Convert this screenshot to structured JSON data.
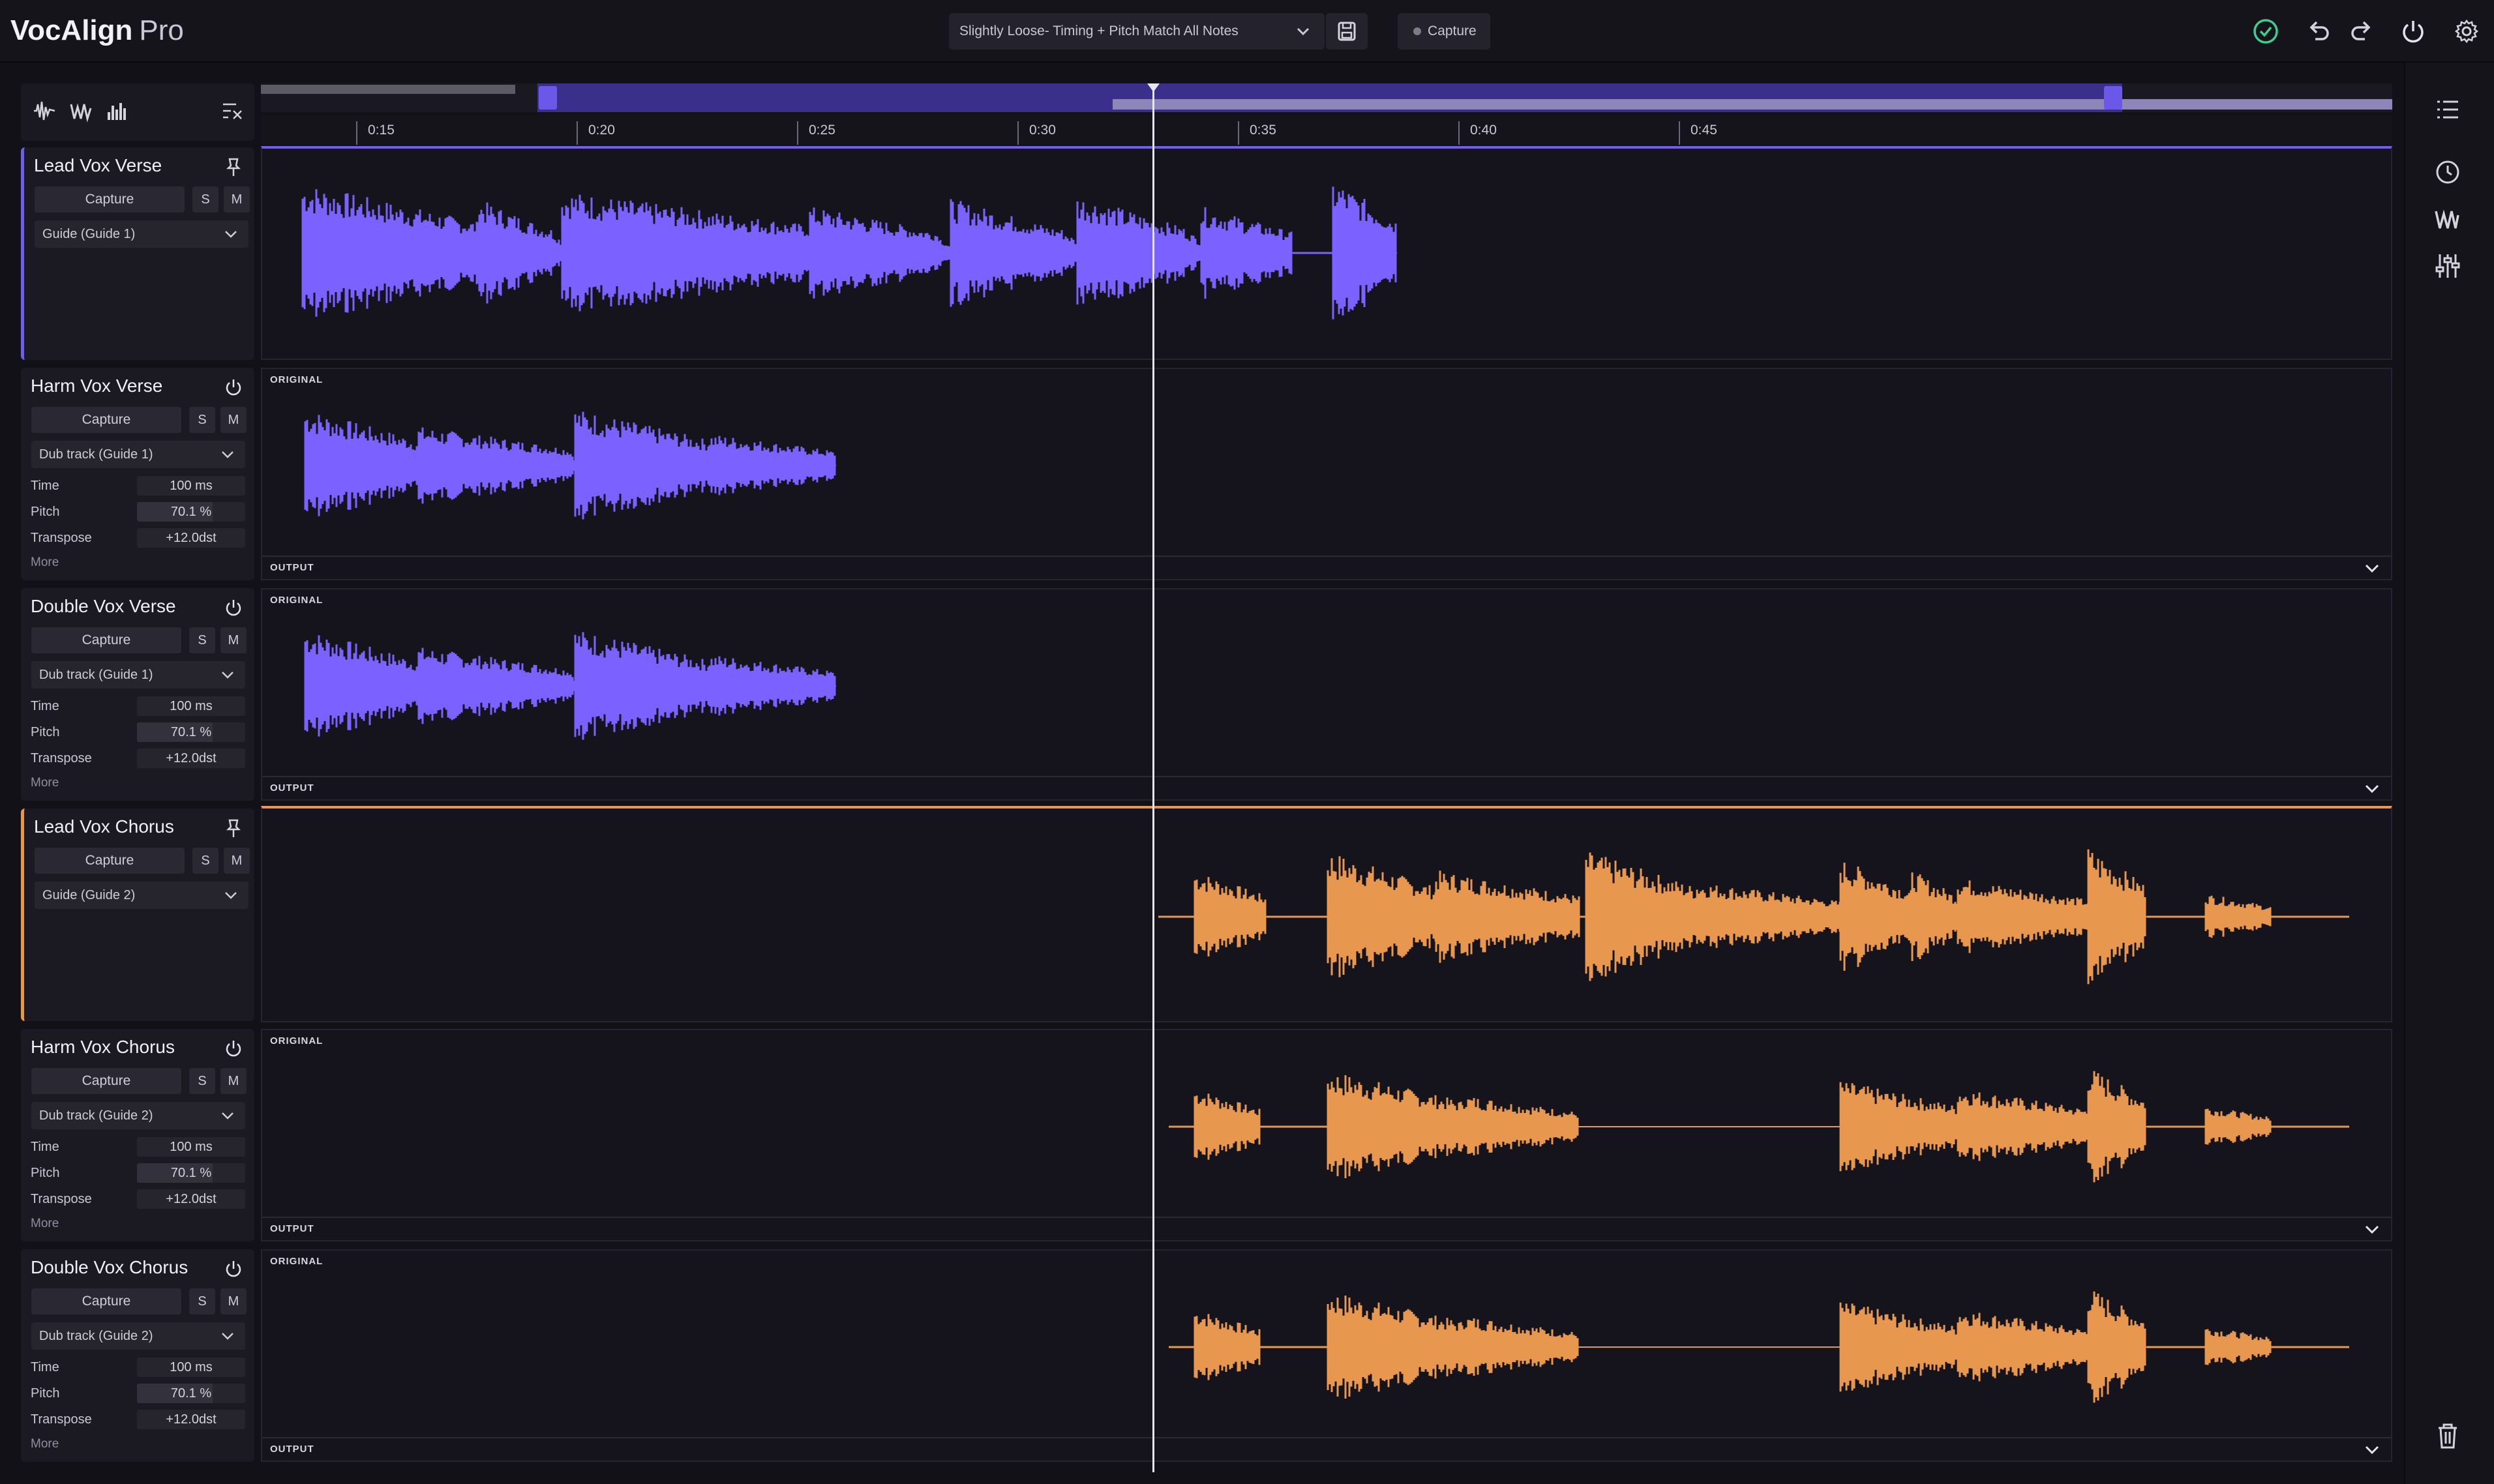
{
  "app": {
    "name_bold": "VocAlign",
    "name_light": "Pro"
  },
  "toolbar": {
    "preset": "Slightly Loose- Timing + Pitch Match All Notes",
    "capture_label": "Capture"
  },
  "colors": {
    "guide1": "#7b61ff",
    "guide2": "#e8974f",
    "background": "#121118",
    "status_ok": "#3ecf8e"
  },
  "icons": {
    "top_right": [
      "check-circle-icon",
      "undo-icon",
      "redo-icon",
      "power-icon",
      "gear-icon"
    ],
    "right_panel": [
      "list-icon",
      "clock-icon",
      "waveform-w-icon",
      "sliders-icon",
      "trash-icon"
    ],
    "tools": [
      "waveform-tool-icon",
      "pitch-tool-icon",
      "bars-tool-icon",
      "clear-tool-icon"
    ]
  },
  "ruler": {
    "ticks": [
      "0:15",
      "0:20",
      "0:25",
      "0:30",
      "0:35",
      "0:40",
      "0:45"
    ]
  },
  "labels": {
    "original": "ORIGINAL",
    "output": "OUTPUT",
    "capture": "Capture",
    "solo": "S",
    "mute": "M",
    "time": "Time",
    "pitch": "Pitch",
    "transpose": "Transpose",
    "more": "More"
  },
  "tracks": [
    {
      "name": "Lead Vox Verse",
      "role": "Guide (Guide 1)",
      "type": "guide",
      "group": 1
    },
    {
      "name": "Harm Vox Verse",
      "role": "Dub track (Guide 1)",
      "type": "dub",
      "group": 1,
      "time": "100 ms",
      "pitch": "70.1 %",
      "pitch_level": 0.701,
      "transpose": "+12.0dst"
    },
    {
      "name": "Double Vox Verse",
      "role": "Dub track (Guide 1)",
      "type": "dub",
      "group": 1,
      "time": "100 ms",
      "pitch": "70.1 %",
      "pitch_level": 0.701,
      "transpose": "+12.0dst"
    },
    {
      "name": "Lead Vox Chorus",
      "role": "Guide (Guide 2)",
      "type": "guide",
      "group": 2
    },
    {
      "name": "Harm Vox Chorus",
      "role": "Dub track (Guide 2)",
      "type": "dub",
      "group": 2,
      "time": "100 ms",
      "pitch": "70.1 %",
      "pitch_level": 0.701,
      "transpose": "+12.0dst"
    },
    {
      "name": "Double Vox Chorus",
      "role": "Dub track (Guide 2)",
      "type": "dub",
      "group": 2,
      "time": "100 ms",
      "pitch": "70.1 %",
      "pitch_level": 0.701,
      "transpose": "+12.0dst"
    }
  ]
}
